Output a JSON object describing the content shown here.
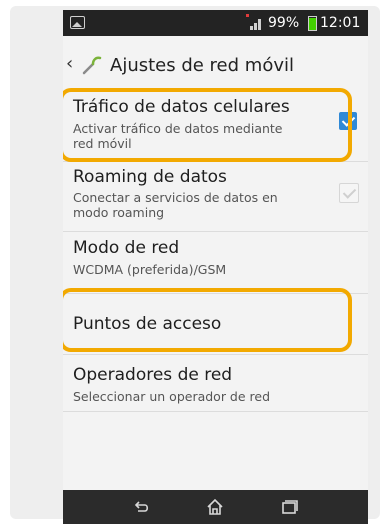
{
  "status_bar": {
    "battery": "99%",
    "time": "12:01"
  },
  "header": {
    "title": "Ajustes de red móvil"
  },
  "settings": [
    {
      "title": "Tráfico de datos celulares",
      "subtitle": "Activar tráfico de datos mediante red móvil",
      "checkbox": true,
      "enabled": true
    },
    {
      "title": "Roaming de datos",
      "subtitle": "Conectar a servicios de datos en modo roaming",
      "checkbox": false,
      "enabled": false
    },
    {
      "title": "Modo de red",
      "subtitle": "WCDMA (preferida)/GSM"
    },
    {
      "title": "Puntos de acceso",
      "subtitle": ""
    },
    {
      "title": "Operadores de red",
      "subtitle": "Seleccionar un operador de red"
    }
  ],
  "colors": {
    "highlight": "#f2a900",
    "checkbox_on": "#2f89d6",
    "status_bar": "#232323",
    "nav_bar": "#2b2b2b"
  },
  "icons": [
    "image-icon",
    "signal-icon",
    "battery-icon",
    "back-chevron-icon",
    "wrench-icon",
    "back-icon",
    "home-icon",
    "recents-icon"
  ]
}
